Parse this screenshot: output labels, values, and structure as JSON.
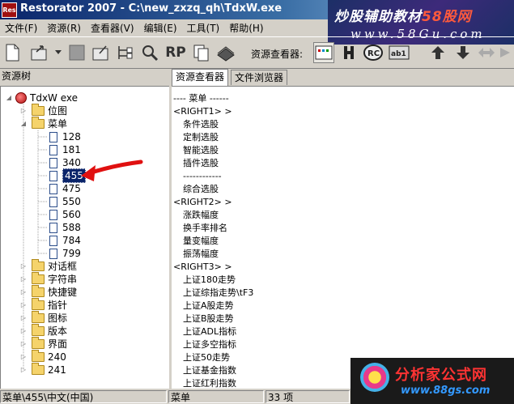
{
  "window": {
    "title": "Restorator 2007 - C:\\new_zxzq_qh\\TdxW.exe",
    "app_icon_text": "Res"
  },
  "menu": [
    "文件(F)",
    "资源(R)",
    "查看器(V)",
    "编辑(E)",
    "工具(T)",
    "帮助(H)"
  ],
  "toolbar": {
    "viewer_label": "资源查看器:",
    "rp_label": "RP"
  },
  "left_pane": {
    "header": "资源树",
    "root": "TdxW exe",
    "nodes": [
      {
        "label": "位图",
        "type": "folder",
        "expanded": false
      },
      {
        "label": "菜单",
        "type": "folder",
        "expanded": true
      },
      {
        "label": "128",
        "type": "item"
      },
      {
        "label": "181",
        "type": "item"
      },
      {
        "label": "340",
        "type": "item"
      },
      {
        "label": "455",
        "type": "item",
        "selected": true
      },
      {
        "label": "475",
        "type": "item"
      },
      {
        "label": "550",
        "type": "item"
      },
      {
        "label": "560",
        "type": "item"
      },
      {
        "label": "588",
        "type": "item"
      },
      {
        "label": "784",
        "type": "item"
      },
      {
        "label": "799",
        "type": "item"
      },
      {
        "label": "对话框",
        "type": "folder",
        "expanded": false
      },
      {
        "label": "字符串",
        "type": "folder",
        "expanded": false
      },
      {
        "label": "快捷键",
        "type": "folder",
        "expanded": false
      },
      {
        "label": "指针",
        "type": "folder",
        "expanded": false
      },
      {
        "label": "图标",
        "type": "folder",
        "expanded": false
      },
      {
        "label": "版本",
        "type": "folder",
        "expanded": false
      },
      {
        "label": "界面",
        "type": "folder",
        "expanded": false
      },
      {
        "label": "240",
        "type": "folder",
        "expanded": false
      },
      {
        "label": "241",
        "type": "folder",
        "expanded": false
      }
    ]
  },
  "right_pane": {
    "tabs": [
      "资源查看器",
      "文件浏览器"
    ],
    "active_tab": 0,
    "lines": [
      {
        "text": "---- 菜单 ------",
        "indent": 0
      },
      {
        "text": "<RIGHT1> >",
        "indent": 0
      },
      {
        "text": "条件选股",
        "indent": 1
      },
      {
        "text": "定制选股",
        "indent": 1
      },
      {
        "text": "智能选股",
        "indent": 1
      },
      {
        "text": "插件选股",
        "indent": 1
      },
      {
        "text": "------------",
        "indent": 1
      },
      {
        "text": "综合选股",
        "indent": 1
      },
      {
        "text": "<RIGHT2> >",
        "indent": 0
      },
      {
        "text": "涨跌幅度",
        "indent": 1
      },
      {
        "text": "换手率排名",
        "indent": 1
      },
      {
        "text": "量变幅度",
        "indent": 1
      },
      {
        "text": "振荡幅度",
        "indent": 1
      },
      {
        "text": "<RIGHT3> >",
        "indent": 0
      },
      {
        "text": "上证180走势",
        "indent": 1
      },
      {
        "text": "上证综指走势\\tF3",
        "indent": 1
      },
      {
        "text": "上证A股走势",
        "indent": 1
      },
      {
        "text": "上证B股走势",
        "indent": 1
      },
      {
        "text": "上证ADL指标",
        "indent": 1
      },
      {
        "text": "上证多空指标",
        "indent": 1
      },
      {
        "text": "上证50走势",
        "indent": 1
      },
      {
        "text": "上证基金指数",
        "indent": 1
      },
      {
        "text": "上证红利指数",
        "indent": 1
      }
    ]
  },
  "statusbar": {
    "path": "菜单\\455\\中文(中国)",
    "type": "菜单",
    "count": "33 项"
  },
  "watermarks": {
    "top_line1": "炒股辅助教材",
    "top_line1_accent": "58股网",
    "top_line2": "www.58Gu.com",
    "bottom_line1": "分析家公式网",
    "bottom_line2": "www.88gs.com"
  },
  "colors": {
    "title_gradient_start": "#0a246a",
    "selection": "#0a246a",
    "annotation_arrow": "#e01010"
  }
}
